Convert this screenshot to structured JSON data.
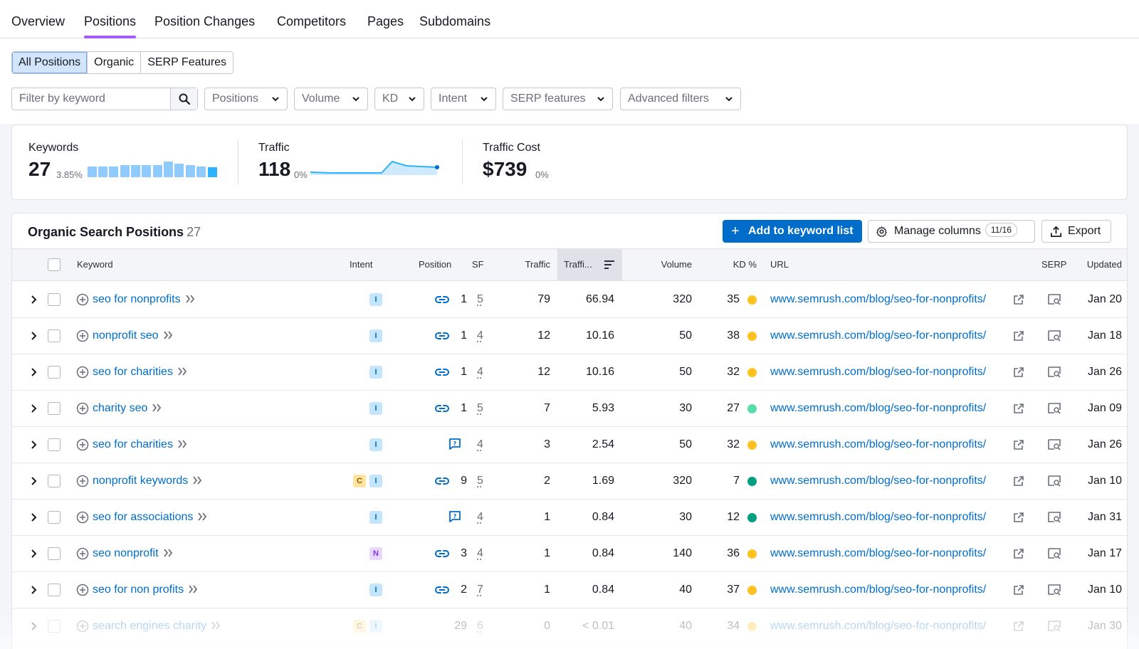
{
  "tabs": [
    {
      "label": "Overview",
      "active": false
    },
    {
      "label": "Positions",
      "active": true
    },
    {
      "label": "Position Changes",
      "active": false
    },
    {
      "label": "Competitors",
      "active": false
    },
    {
      "label": "Pages",
      "active": false
    },
    {
      "label": "Subdomains",
      "active": false
    }
  ],
  "segments": [
    {
      "label": "All Positions",
      "active": true
    },
    {
      "label": "Organic",
      "active": false
    },
    {
      "label": "SERP Features",
      "active": false
    }
  ],
  "filters": {
    "keyword_placeholder": "Filter by keyword",
    "dropdowns": [
      "Positions",
      "Volume",
      "KD",
      "Intent",
      "SERP features",
      "Advanced filters"
    ]
  },
  "summary": {
    "keywords": {
      "label": "Keywords",
      "value": "27",
      "delta": "3.85%"
    },
    "traffic": {
      "label": "Traffic",
      "value": "118",
      "delta": "0%"
    },
    "traffic_cost": {
      "label": "Traffic Cost",
      "value": "$739",
      "delta": "0%"
    }
  },
  "colors": {
    "accent": "#006dca",
    "tab_underline": "#a35cf5",
    "kd_yellow": "#ffc220",
    "kd_lightgreen": "#59ddaa",
    "kd_green": "#009f81"
  },
  "table": {
    "title": "Organic Search Positions",
    "count": "27",
    "add_button": "Add to keyword list",
    "manage_columns": "Manage columns",
    "manage_columns_badge": "11/16",
    "export": "Export",
    "headers": {
      "keyword": "Keyword",
      "intent": "Intent",
      "position": "Position",
      "sf": "SF",
      "traffic": "Traffic",
      "traffic_pct": "Traffi...",
      "volume": "Volume",
      "kd": "KD %",
      "url": "URL",
      "serp": "SERP",
      "updated": "Updated"
    },
    "rows": [
      {
        "keyword": "seo for nonprofits",
        "intents": [
          "I"
        ],
        "pos_icon": "link-icon",
        "position": "1",
        "sf": "5",
        "traffic": "79",
        "traffic_pct": "66.94",
        "volume": "320",
        "kd": "35",
        "kd_color": "#ffc220",
        "url": "www.semrush.com/blog/seo-for-nonprofits/",
        "updated": "Jan 20"
      },
      {
        "keyword": "nonprofit seo",
        "intents": [
          "I"
        ],
        "pos_icon": "link-icon",
        "position": "1",
        "sf": "4",
        "traffic": "12",
        "traffic_pct": "10.16",
        "volume": "50",
        "kd": "38",
        "kd_color": "#ffc220",
        "url": "www.semrush.com/blog/seo-for-nonprofits/",
        "updated": "Jan 18"
      },
      {
        "keyword": "seo for charities",
        "intents": [
          "I"
        ],
        "pos_icon": "link-icon",
        "position": "1",
        "sf": "4",
        "traffic": "12",
        "traffic_pct": "10.16",
        "volume": "50",
        "kd": "32",
        "kd_color": "#ffc220",
        "url": "www.semrush.com/blog/seo-for-nonprofits/",
        "updated": "Jan 26"
      },
      {
        "keyword": "charity seo",
        "intents": [
          "I"
        ],
        "pos_icon": "link-icon",
        "position": "1",
        "sf": "5",
        "traffic": "7",
        "traffic_pct": "5.93",
        "volume": "30",
        "kd": "27",
        "kd_color": "#59ddaa",
        "url": "www.semrush.com/blog/seo-for-nonprofits/",
        "updated": "Jan 09"
      },
      {
        "keyword": "seo for charities",
        "intents": [
          "I"
        ],
        "pos_icon": "faq-icon",
        "position": "",
        "sf": "4",
        "traffic": "3",
        "traffic_pct": "2.54",
        "volume": "50",
        "kd": "32",
        "kd_color": "#ffc220",
        "url": "www.semrush.com/blog/seo-for-nonprofits/",
        "updated": "Jan 26"
      },
      {
        "keyword": "nonprofit keywords",
        "intents": [
          "C",
          "I"
        ],
        "pos_icon": "link-icon",
        "position": "9",
        "sf": "5",
        "traffic": "2",
        "traffic_pct": "1.69",
        "volume": "320",
        "kd": "7",
        "kd_color": "#009f81",
        "url": "www.semrush.com/blog/seo-for-nonprofits/",
        "updated": "Jan 10"
      },
      {
        "keyword": "seo for associations",
        "intents": [
          "I"
        ],
        "pos_icon": "faq-icon",
        "position": "",
        "sf": "4",
        "traffic": "1",
        "traffic_pct": "0.84",
        "volume": "30",
        "kd": "12",
        "kd_color": "#009f81",
        "url": "www.semrush.com/blog/seo-for-nonprofits/",
        "updated": "Jan 31"
      },
      {
        "keyword": "seo nonprofit",
        "intents": [
          "N"
        ],
        "pos_icon": "link-icon",
        "position": "3",
        "sf": "4",
        "traffic": "1",
        "traffic_pct": "0.84",
        "volume": "140",
        "kd": "36",
        "kd_color": "#ffc220",
        "url": "www.semrush.com/blog/seo-for-nonprofits/",
        "updated": "Jan 17"
      },
      {
        "keyword": "seo for non profits",
        "intents": [
          "I"
        ],
        "pos_icon": "link-icon",
        "position": "2",
        "sf": "7",
        "traffic": "1",
        "traffic_pct": "0.84",
        "volume": "40",
        "kd": "37",
        "kd_color": "#ffc220",
        "url": "www.semrush.com/blog/seo-for-nonprofits/",
        "updated": "Jan 10"
      },
      {
        "keyword": "search engines charity",
        "intents": [
          "C",
          "I"
        ],
        "pos_icon": "",
        "position": "29",
        "sf": "6",
        "traffic": "0",
        "traffic_pct": "< 0.01",
        "volume": "40",
        "kd": "34",
        "kd_color": "#ffc220",
        "url": "www.semrush.com/blog/seo-for-nonprofits/",
        "updated": "Jan 30"
      }
    ]
  }
}
